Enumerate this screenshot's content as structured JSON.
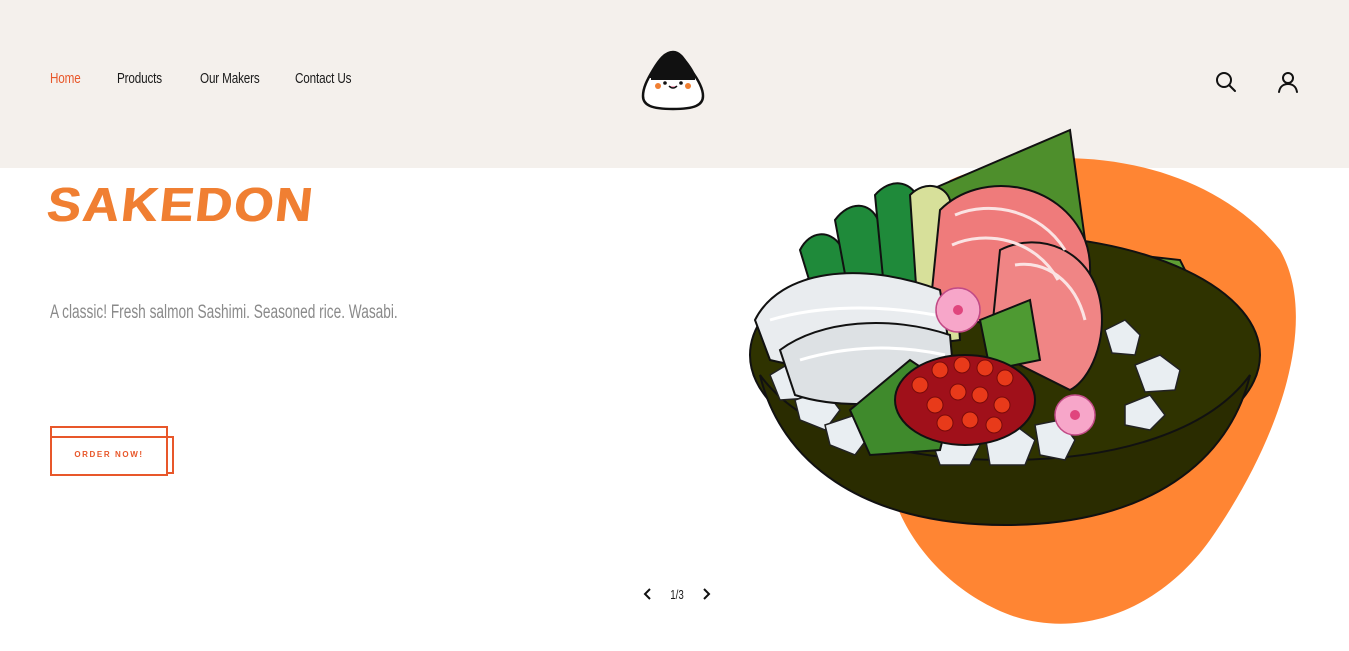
{
  "nav": {
    "items": [
      {
        "label": "Home",
        "active": true
      },
      {
        "label": "Products",
        "active": false
      },
      {
        "label": "Our Makers",
        "active": false
      },
      {
        "label": "Contact Us",
        "active": false
      }
    ]
  },
  "header": {
    "logo_icon": "onigiri-logo-icon",
    "search_icon": "search-icon",
    "account_icon": "user-icon"
  },
  "hero": {
    "title": "SAKEDON",
    "subtitle": "A classic! Fresh salmon Sashimi. Seasoned rice. Wasabi.",
    "cta_label": "ORDER NOW!",
    "image_icon": "sashimi-bowl-illustration"
  },
  "pager": {
    "label": "1/3",
    "prev_icon": "chevron-left-icon",
    "next_icon": "chevron-right-icon"
  },
  "colors": {
    "accent": "#f07f32",
    "nav_active": "#e8572a",
    "header_bg": "#f4f0ec",
    "blob": "#ff8533"
  }
}
